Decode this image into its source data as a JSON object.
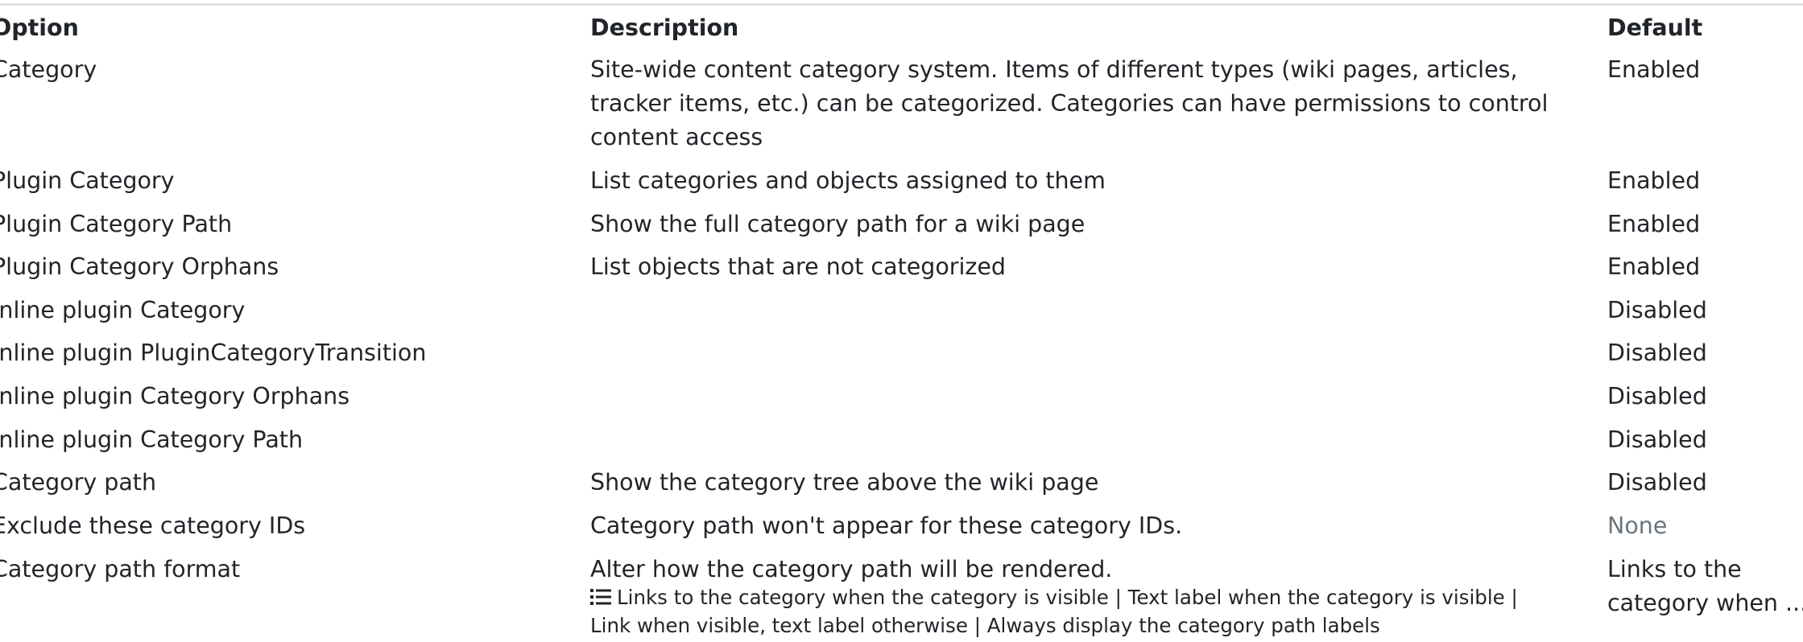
{
  "header": {
    "option": "Option",
    "description": "Description",
    "default": "Default"
  },
  "rows": [
    {
      "option": "Category",
      "description_lines": [
        "Site-wide content category system. Items of different types (wiki pages, articles,",
        "tracker items, etc.) can be categorized. Categories can have permissions to control",
        "content access"
      ],
      "default": "Enabled"
    },
    {
      "option": "Plugin Category",
      "description": "List categories and objects assigned to them",
      "default": "Enabled"
    },
    {
      "option": "Plugin Category Path",
      "description": "Show the full category path for a wiki page",
      "default": "Enabled"
    },
    {
      "option": "Plugin Category Orphans",
      "description": "List objects that are not categorized",
      "default": "Enabled"
    },
    {
      "option": "Inline plugin Category",
      "description": "",
      "default": "Disabled"
    },
    {
      "option": "Inline plugin PluginCategoryTransition",
      "description": "",
      "default": "Disabled"
    },
    {
      "option": "Inline plugin Category Orphans",
      "description": "",
      "default": "Disabled"
    },
    {
      "option": "Inline plugin Category Path",
      "description": "",
      "default": "Disabled"
    },
    {
      "option": "Category path",
      "description": "Show the category tree above the wiki page",
      "default": "Disabled"
    },
    {
      "option": "Exclude these category IDs",
      "description": "Category path won't appear for these category IDs.",
      "default": "None"
    },
    {
      "option": "Category path format",
      "description": "Alter how the category path will be rendered.",
      "options_line1": "Links to the category when the category is visible | Text label when the category is visible |",
      "options_line2": "Link when visible, text label otherwise | Always display the category path labels",
      "options_icon": "list-icon",
      "default_lines": [
        "Links to the",
        "category when ..."
      ]
    }
  ]
}
